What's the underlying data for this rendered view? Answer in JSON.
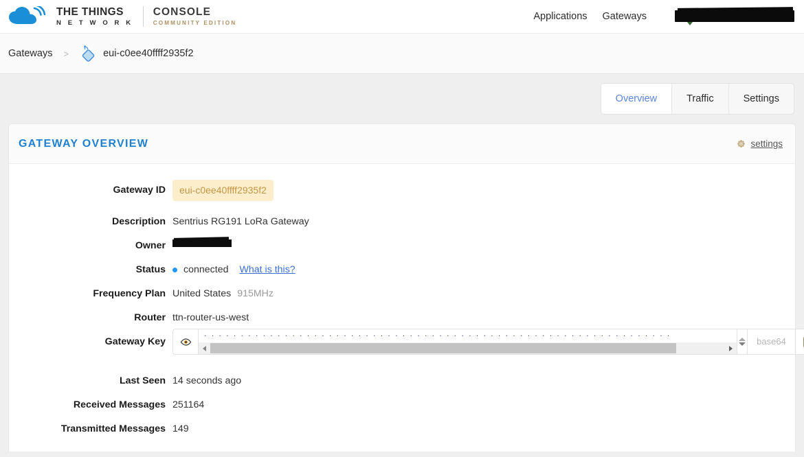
{
  "brand": {
    "line1": "THE THINGS",
    "line2": "N E T W O R K",
    "console": "CONSOLE",
    "edition": "COMMUNITY EDITION",
    "cloud_color": "#1a8fd8",
    "edition_color": "#b08f62"
  },
  "topnav": {
    "items": [
      {
        "label": "Applications"
      },
      {
        "label": "Gateways"
      }
    ],
    "user": {
      "label": "",
      "redacted": true
    }
  },
  "breadcrumb": {
    "root": "Gateways",
    "separator": ">",
    "current": "eui-c0ee40ffff2935f2",
    "icon": "gateway-icon"
  },
  "tabs": [
    {
      "label": "Overview",
      "active": true
    },
    {
      "label": "Traffic",
      "active": false
    },
    {
      "label": "Settings",
      "active": false
    }
  ],
  "card": {
    "title": "GATEWAY OVERVIEW",
    "title_color": "#1f80d0",
    "settings_label": "settings",
    "settings_icon": "gear-icon"
  },
  "overview": {
    "gateway_id": {
      "label": "Gateway ID",
      "value": "eui-c0ee40ffff2935f2",
      "badge_bg": "#fdeecb",
      "badge_fg": "#c49646"
    },
    "description": {
      "label": "Description",
      "value": "Sentrius RG191 LoRa Gateway"
    },
    "owner": {
      "label": "Owner",
      "value": "",
      "redacted": true
    },
    "status": {
      "label": "Status",
      "value": "connected",
      "dot_color": "#2196f3",
      "help_link": "What is this?"
    },
    "frequency_plan": {
      "label": "Frequency Plan",
      "value": "United States",
      "sub_value": "915MHz"
    },
    "router": {
      "label": "Router",
      "value": "ttn-router-us-west"
    },
    "gateway_key": {
      "label": "Gateway Key",
      "masked_value": "································································",
      "format": "base64",
      "eye_icon": "eye-icon",
      "copy_icon": "clipboard-icon",
      "spinner_icon": "spinner-icon"
    },
    "last_seen": {
      "label": "Last Seen",
      "value": "14 seconds ago"
    },
    "received_messages": {
      "label": "Received Messages",
      "value": "251164"
    },
    "transmitted_messages": {
      "label": "Transmitted Messages",
      "value": "149"
    }
  }
}
